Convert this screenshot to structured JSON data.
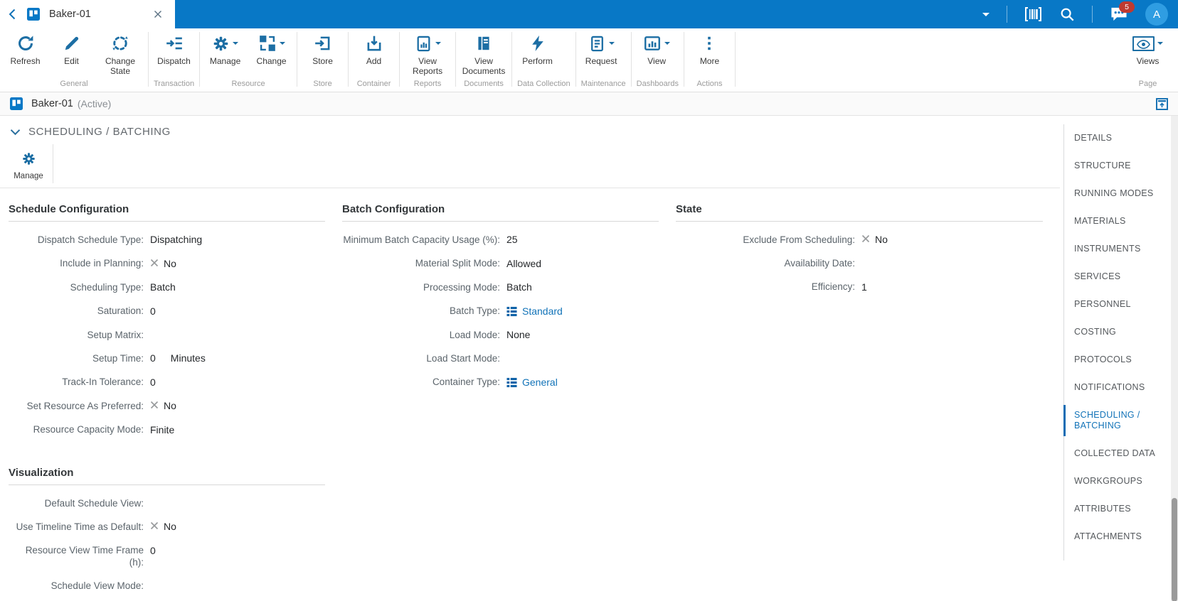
{
  "colors": {
    "accent": "#0878c6",
    "ribbon_icon": "#1c6ea4",
    "link": "#1273b8",
    "badge": "#bf3a30",
    "avatar": "#2f9de2"
  },
  "topbar": {
    "tab": {
      "title": "Baker-01"
    },
    "notifications_badge": "5",
    "avatar_initial": "A"
  },
  "ribbon": {
    "groups": [
      {
        "label": "General",
        "buttons": [
          {
            "label": "Refresh"
          },
          {
            "label": "Edit"
          },
          {
            "label": "Change State"
          }
        ]
      },
      {
        "label": "Transaction",
        "buttons": [
          {
            "label": "Dispatch"
          }
        ]
      },
      {
        "label": "Resource",
        "buttons": [
          {
            "label": "Manage"
          },
          {
            "label": "Change"
          }
        ]
      },
      {
        "label": "Store",
        "buttons": [
          {
            "label": "Store"
          }
        ]
      },
      {
        "label": "Container",
        "buttons": [
          {
            "label": "Add"
          }
        ]
      },
      {
        "label": "Reports",
        "buttons": [
          {
            "label": "View Reports"
          }
        ]
      },
      {
        "label": "Documents",
        "buttons": [
          {
            "label": "View Documents"
          }
        ]
      },
      {
        "label": "Data Collection",
        "buttons": [
          {
            "label": "Perform"
          }
        ]
      },
      {
        "label": "Maintenance",
        "buttons": [
          {
            "label": "Request"
          }
        ]
      },
      {
        "label": "Dashboards",
        "buttons": [
          {
            "label": "View"
          }
        ]
      },
      {
        "label": "Actions",
        "buttons": [
          {
            "label": "More"
          }
        ]
      },
      {
        "label": "Page",
        "buttons": [
          {
            "label": "Views"
          }
        ]
      }
    ]
  },
  "titlebar": {
    "name": "Baker-01",
    "status": "(Active)"
  },
  "section": {
    "title": "SCHEDULING / BATCHING",
    "toolbar": {
      "manage_label": "Manage"
    }
  },
  "panels": [
    {
      "title": "Schedule Configuration",
      "rows": [
        {
          "label": "Dispatch Schedule Type:",
          "value": "Dispatching"
        },
        {
          "label": "Include in Planning:",
          "x": true,
          "value": "No"
        },
        {
          "label": "Scheduling Type:",
          "value": "Batch"
        },
        {
          "label": "Saturation:",
          "value": "0"
        },
        {
          "label": "Setup Matrix:",
          "value": ""
        },
        {
          "label": "Setup Time:",
          "value": "0",
          "unit": "Minutes"
        },
        {
          "label": "Track-In Tolerance:",
          "value": "0"
        },
        {
          "label": "Set Resource As Preferred:",
          "x": true,
          "value": "No"
        },
        {
          "label": "Resource Capacity Mode:",
          "value": "Finite"
        }
      ]
    },
    {
      "title": "Batch Configuration",
      "rows": [
        {
          "label": "Minimum Batch Capacity Usage (%):",
          "value": "25"
        },
        {
          "label": "Material Split Mode:",
          "value": "Allowed"
        },
        {
          "label": "Processing Mode:",
          "value": "Batch"
        },
        {
          "label": "Batch Type:",
          "link": true,
          "value": "Standard"
        },
        {
          "label": "Load Mode:",
          "value": "None"
        },
        {
          "label": "Load Start Mode:",
          "value": ""
        },
        {
          "label": "Container Type:",
          "link": true,
          "value": "General"
        }
      ]
    },
    {
      "title": "State",
      "rows": [
        {
          "label": "Exclude From Scheduling:",
          "x": true,
          "value": "No"
        },
        {
          "label": "Availability Date:",
          "value": ""
        },
        {
          "label": "Efficiency:",
          "value": "1"
        }
      ]
    },
    {
      "title": "Visualization",
      "rows": [
        {
          "label": "Default Schedule View:",
          "value": ""
        },
        {
          "label": "Use Timeline Time as Default:",
          "x": true,
          "value": "No"
        },
        {
          "label": "Resource View Time Frame (h):",
          "value": "0"
        },
        {
          "label": "Schedule View Mode:",
          "value": ""
        }
      ]
    }
  ],
  "sidebar": {
    "items": [
      {
        "label": "DETAILS"
      },
      {
        "label": "STRUCTURE"
      },
      {
        "label": "RUNNING MODES"
      },
      {
        "label": "MATERIALS"
      },
      {
        "label": "INSTRUMENTS"
      },
      {
        "label": "SERVICES"
      },
      {
        "label": "PERSONNEL"
      },
      {
        "label": "COSTING"
      },
      {
        "label": "PROTOCOLS"
      },
      {
        "label": "NOTIFICATIONS"
      },
      {
        "label": "SCHEDULING / BATCHING",
        "active": true
      },
      {
        "label": "COLLECTED DATA"
      },
      {
        "label": "WORKGROUPS"
      },
      {
        "label": "ATTRIBUTES"
      },
      {
        "label": "ATTACHMENTS"
      }
    ]
  }
}
